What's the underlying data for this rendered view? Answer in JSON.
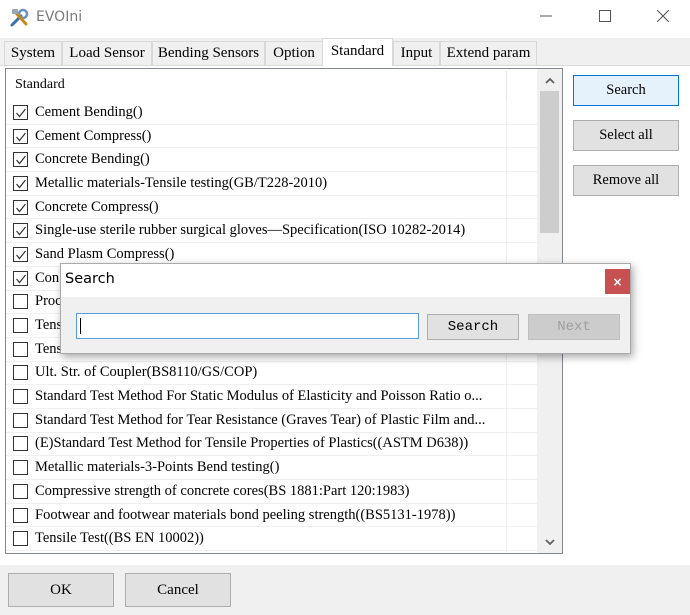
{
  "window": {
    "title": "EVOIni",
    "icon": "tools-icon",
    "controls": {
      "minimize": "minimize-icon",
      "maximize": "maximize-icon",
      "close": "close-icon"
    }
  },
  "tabs": [
    {
      "label": "System",
      "active": false
    },
    {
      "label": "Load Sensor",
      "active": false
    },
    {
      "label": "Bending Sensors",
      "active": false
    },
    {
      "label": "Option",
      "active": false
    },
    {
      "label": "Standard",
      "active": true
    },
    {
      "label": "Input",
      "active": false
    },
    {
      "label": "Extend param",
      "active": false
    }
  ],
  "list": {
    "header": "Standard",
    "rows": [
      {
        "label": "Cement Bending()",
        "checked": true
      },
      {
        "label": "Cement Compress()",
        "checked": true
      },
      {
        "label": "Concrete Bending()",
        "checked": true
      },
      {
        "label": "Metallic materials-Tensile testing(GB/T228-2010)",
        "checked": true
      },
      {
        "label": "Concrete Compress()",
        "checked": true
      },
      {
        "label": "Single-use sterile rubber surgical gloves—Specification(ISO 10282-2014)",
        "checked": true
      },
      {
        "label": "Sand Plasm Compress()",
        "checked": true
      },
      {
        "label": "Con",
        "checked": true
      },
      {
        "label": "Proc",
        "checked": false
      },
      {
        "label": "Tens",
        "checked": false
      },
      {
        "label": "Tens",
        "checked": false
      },
      {
        "label": "Ult. Str. of Coupler(BS8110/GS/COP)",
        "checked": false
      },
      {
        "label": "Standard Test Method For Static Modulus of Elasticity and Poisson Ratio o...",
        "checked": false
      },
      {
        "label": "Standard Test Method for Tear Resistance (Graves Tear) of Plastic Film and...",
        "checked": false
      },
      {
        "label": "(E)Standard Test Method for Tensile Properties of Plastics((ASTM D638))",
        "checked": false
      },
      {
        "label": "Metallic materials-3-Points Bend testing()",
        "checked": false
      },
      {
        "label": "Compressive strength of concrete cores(BS 1881:Part 120:1983)",
        "checked": false
      },
      {
        "label": "Footwear and footwear materials bond peeling strength((BS5131-1978))",
        "checked": false
      },
      {
        "label": "Tensile Test((BS EN 10002))",
        "checked": false
      }
    ]
  },
  "side_buttons": {
    "search": "Search",
    "select_all": "Select all",
    "remove_all": "Remove all"
  },
  "bottom_buttons": {
    "ok": "OK",
    "cancel": "Cancel"
  },
  "search_dialog": {
    "title": "Search",
    "input_value": "",
    "search_label": "Search",
    "next_label": "Next",
    "next_enabled": false,
    "close_glyph": "×"
  },
  "colors": {
    "accent": "#0078d7",
    "dialog_close_bg": "#c75050",
    "input_border": "#569de5"
  }
}
